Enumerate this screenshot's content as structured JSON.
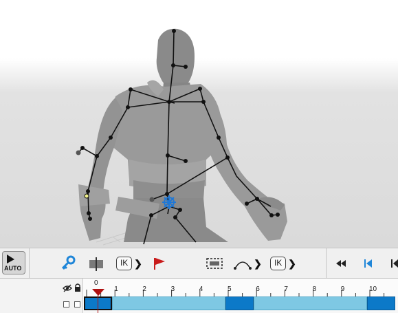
{
  "viewport": {
    "scene": "3D character mesh with bone skeleton overlay",
    "icons": {
      "ik_gizmo": "blue-move-gizmo-icon"
    }
  },
  "toolbar": {
    "auto_key_label": "AUTO",
    "ik_label_1": "IK",
    "ik_label_2": "IK",
    "icons": [
      "auto-key-icon",
      "set-key-icon",
      "split-icon",
      "ik-chevron-icon",
      "flag-icon",
      "frame-select-icon",
      "curve-icon",
      "ik-chevron-icon",
      "rewind-icon",
      "go-to-start-icon",
      "step-back-icon"
    ],
    "colors": {
      "key_icon": "#1f86d8",
      "flag_icon": "#c81a1a",
      "playhead": "#b01010"
    }
  },
  "timeline": {
    "current_frame": "0",
    "tick_labels": [
      "0",
      "1",
      "2",
      "3",
      "4",
      "5",
      "6",
      "7",
      "8",
      "9",
      "10"
    ],
    "segments": [
      {
        "start": 0,
        "end": 1,
        "style": "selected"
      },
      {
        "start": 1,
        "end": 5,
        "style": "light"
      },
      {
        "start": 5,
        "end": 6,
        "style": "dark"
      },
      {
        "start": 6,
        "end": 10,
        "style": "light"
      },
      {
        "start": 10,
        "end": 11,
        "style": "dark"
      }
    ],
    "colors": {
      "light_segment": "#7ec8e3",
      "dark_segment": "#0c79c8"
    }
  }
}
